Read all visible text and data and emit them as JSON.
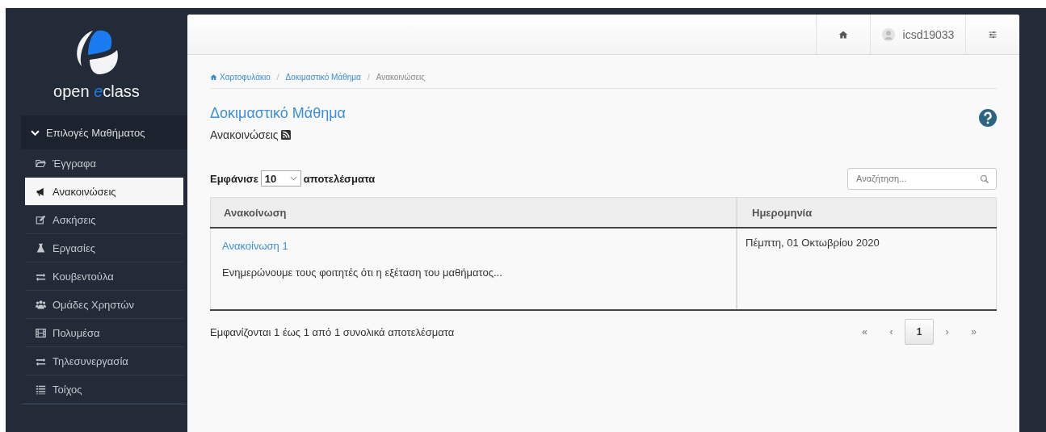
{
  "logo": {
    "text_before": "open ",
    "text_accent": "e",
    "text_after": "class"
  },
  "sidebar": {
    "section": {
      "label": "Επιλογές Μαθήματος",
      "expanded": true
    },
    "items": [
      {
        "label": "Έγγραφα",
        "selected": false
      },
      {
        "label": "Ανακοινώσεις",
        "selected": true
      },
      {
        "label": "Ασκήσεις",
        "selected": false
      },
      {
        "label": "Εργασίες",
        "selected": false
      },
      {
        "label": "Κουβεντούλα",
        "selected": false
      },
      {
        "label": "Ομάδες Χρηστών",
        "selected": false
      },
      {
        "label": "Πολυμέσα",
        "selected": false
      },
      {
        "label": "Τηλεσυνεργασία",
        "selected": false
      },
      {
        "label": "Τοίχος",
        "selected": false
      }
    ]
  },
  "top_bar": {
    "username": "icsd19033"
  },
  "breadcrumb_separator": "/",
  "breadcrumb": [
    "Χαρτοφυλάκιο",
    "Δοκιμαστικό Μάθημα",
    "Ανακοινώσεις"
  ],
  "page_title": "Δοκιμαστικό Μάθημα",
  "page_subtitle": "Ανακοινώσεις",
  "length_control": {
    "label_before": "Εμφάνισε",
    "value": "10",
    "label_after": "αποτελέσματα"
  },
  "search": {
    "placeholder": "Αναζήτηση..."
  },
  "table": {
    "columns": [
      "Ανακοίνωση",
      "Ημερομηνία"
    ],
    "rows": [
      {
        "title": "Ανακοίνωση 1",
        "excerpt": "Ενημερώνουμε τους φοιτητές ότι η εξέταση του μαθήματος...",
        "date": "Πέμπτη, 01 Οκτωβρίου 2020"
      }
    ]
  },
  "info": "Εμφανίζονται 1 έως 1 από 1 συνολικά αποτελέσματα",
  "pagination": [
    {
      "label": "«",
      "selected": false
    },
    {
      "label": "‹",
      "selected": false
    },
    {
      "label": "1",
      "selected": true
    },
    {
      "label": "›",
      "selected": false
    },
    {
      "label": "»",
      "selected": false
    }
  ]
}
